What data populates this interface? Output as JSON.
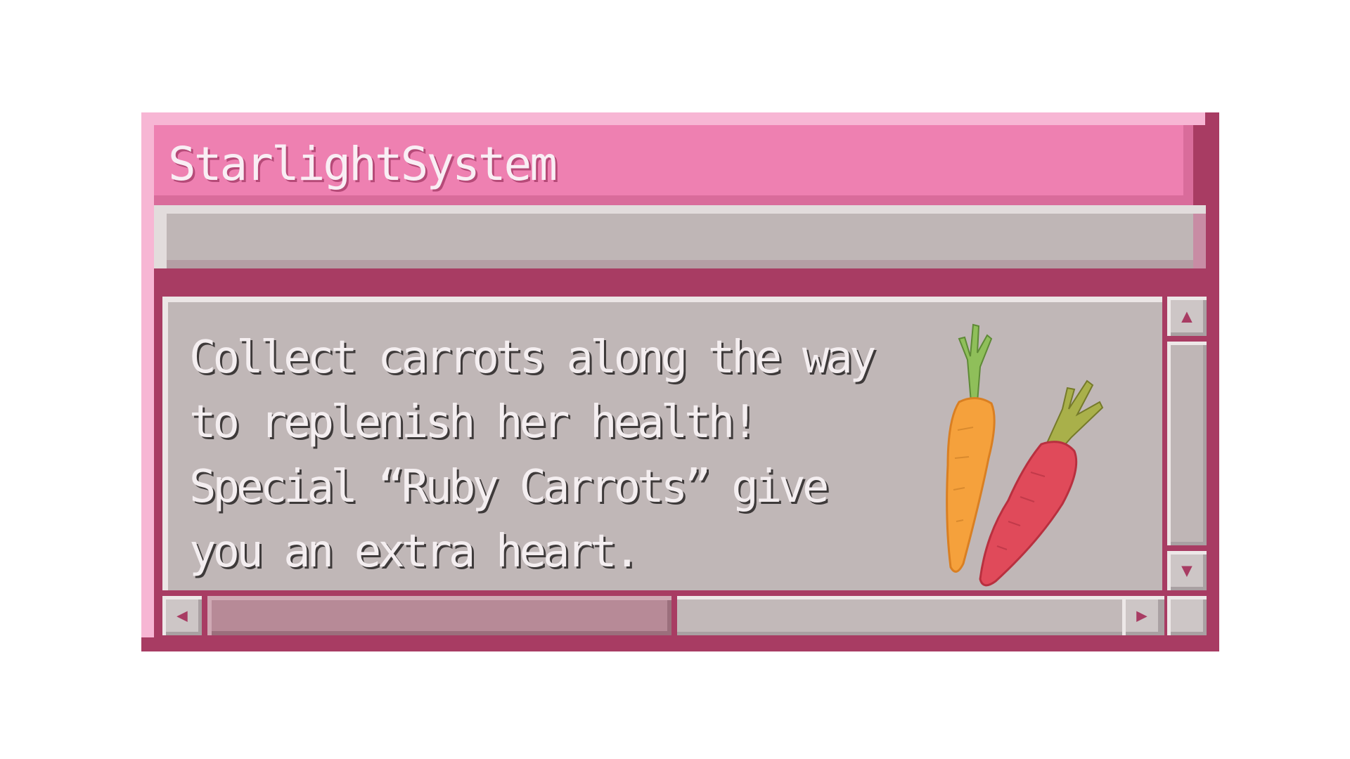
{
  "window": {
    "title": "StarlightSystem",
    "message": "Collect carrots along the way\nto replenish her health!\nSpecial “Ruby Carrots” give\nyou an extra heart."
  },
  "icons": {
    "scroll_up": "▲",
    "scroll_down": "▼",
    "scroll_left": "◀",
    "scroll_right": "▶",
    "illustration": "carrots-illustration"
  },
  "colors": {
    "title_bar": "#ee80b1",
    "frame": "#a83c63",
    "panel": "#c0b7b7",
    "orange_carrot": "#f5a13c",
    "ruby_carrot": "#e04a5a"
  }
}
